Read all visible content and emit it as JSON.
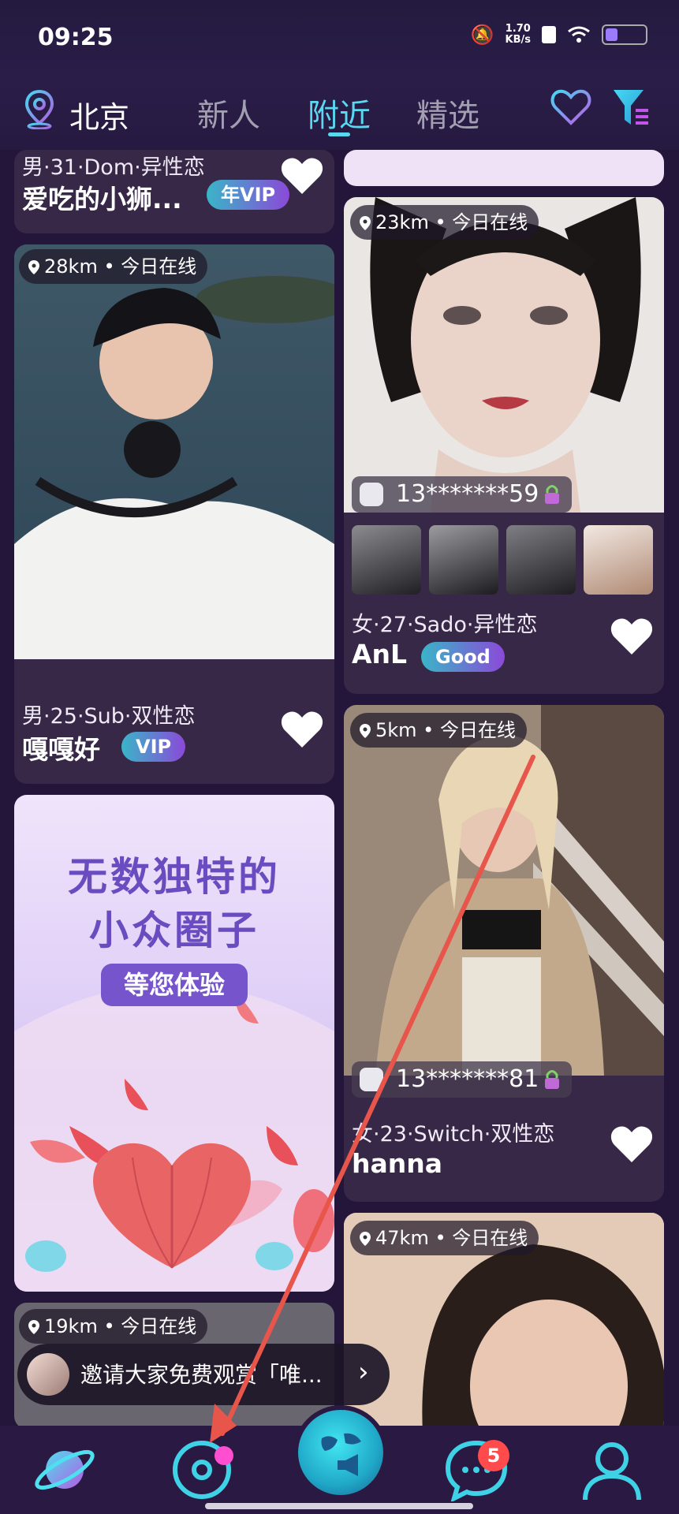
{
  "status_bar": {
    "time": "09:25",
    "speed": "1.70",
    "speed_unit": "KB/s"
  },
  "header": {
    "city": "北京",
    "tabs": [
      {
        "label": "新人"
      },
      {
        "label": "附近",
        "active": true
      },
      {
        "label": "精选"
      }
    ]
  },
  "left_column": {
    "card_top": {
      "meta": "男·31·Dom·异性恋",
      "name": "爱吃的小狮...",
      "badge": "年VIP"
    },
    "card_boy": {
      "distance": "28km • 今日在线",
      "meta": "男·25·Sub·双性恋",
      "name": "嘎嘎好",
      "badge": "VIP"
    },
    "banner": {
      "line1": "无数独特的",
      "line2": "小众圈子",
      "cta": "等您体验"
    },
    "card_bottom": {
      "distance": "19km • 今日在线"
    }
  },
  "right_column": {
    "card_anl": {
      "distance": "23km • 今日在线",
      "phone": "13*******59",
      "meta": "女·27·Sado·异性恋",
      "name": "AnL",
      "badge": "Good"
    },
    "card_hanna": {
      "distance": "5km • 今日在线",
      "phone": "13*******81",
      "meta": "女·23·Switch·双性恋",
      "name": "hanna"
    },
    "card_last": {
      "distance": "47km • 今日在线"
    }
  },
  "invite_toast": {
    "text": "邀请大家免费观赏「唯..."
  },
  "bottom_nav": {
    "messages_badge": "5"
  },
  "colors": {
    "accent": "#5ad8f0",
    "background": "#23163a",
    "card": "#362846",
    "badge_gradient": [
      "#3ab5c8",
      "#8b49d8"
    ],
    "annotation_arrow": "#e8554a"
  }
}
